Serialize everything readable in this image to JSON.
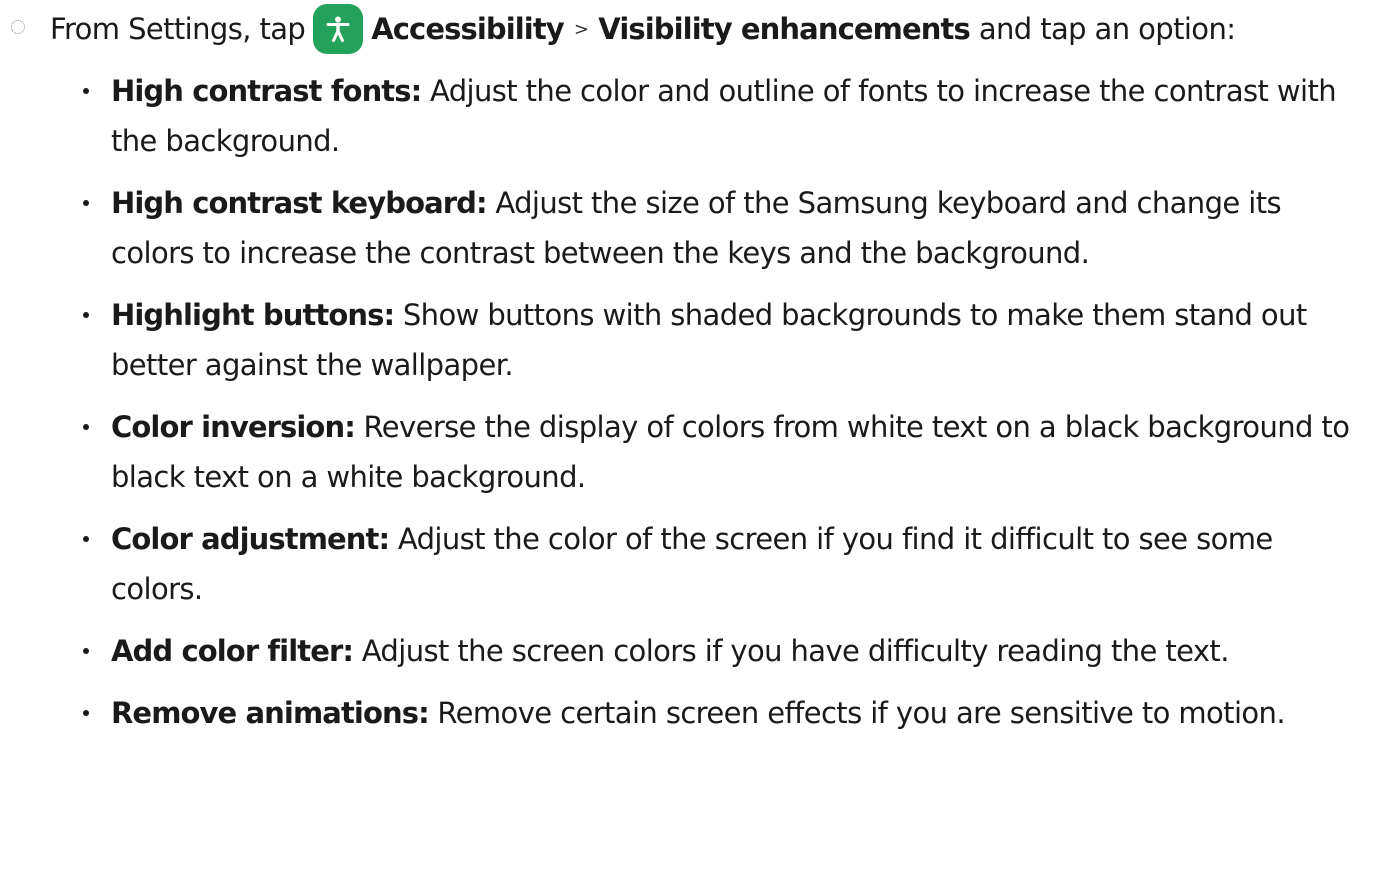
{
  "step": {
    "prefix": "From Settings, tap",
    "icon": "accessibility-icon",
    "icon_color": "#24a15a",
    "menu_1": "Accessibility",
    "separator": ">",
    "menu_2": "Visibility enhancements",
    "suffix": "and tap an option:"
  },
  "options": [
    {
      "name": "High contrast fonts",
      "description": "Adjust the color and outline of fonts to increase the contrast with the background."
    },
    {
      "name": "High contrast keyboard",
      "description": "Adjust the size of the Samsung keyboard and change its colors to increase the contrast between the keys and the background."
    },
    {
      "name": "Highlight buttons",
      "description": "Show buttons with shaded backgrounds to make them stand out better against the wallpaper."
    },
    {
      "name": "Color inversion",
      "description": "Reverse the display of colors from white text on a black background to black text on a white background."
    },
    {
      "name": "Color adjustment",
      "description": "Adjust the color of the screen if you find it difficult to see some colors."
    },
    {
      "name": "Add color filter",
      "description": "Adjust the screen colors if you have difficulty reading the text."
    },
    {
      "name": "Remove animations",
      "description": "Remove certain screen effects if you are sensitive to motion."
    }
  ]
}
